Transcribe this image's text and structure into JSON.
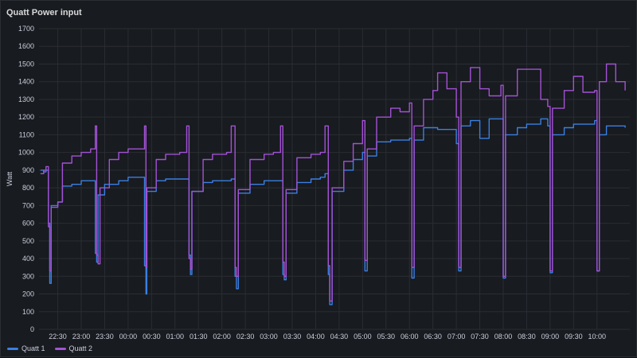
{
  "panel": {
    "title": "Quatt Power input"
  },
  "colors": {
    "quatt1": "#3a7fe3",
    "quatt2": "#a352d6",
    "grid": "#2a2d33",
    "text": "#ccccdc"
  },
  "chart_data": {
    "type": "line",
    "title": "Quatt Power input",
    "ylabel": "Watt",
    "xlabel": "",
    "ylim": [
      0,
      1700
    ],
    "yticks": [
      0,
      100,
      200,
      300,
      400,
      500,
      600,
      700,
      800,
      900,
      1000,
      1100,
      1200,
      1300,
      1400,
      1500,
      1600,
      1700
    ],
    "xlim": [
      22.1,
      34.7
    ],
    "xticks": [
      {
        "v": 22.5,
        "label": "22:30"
      },
      {
        "v": 23.0,
        "label": "23:00"
      },
      {
        "v": 23.5,
        "label": "23:30"
      },
      {
        "v": 24.0,
        "label": "00:00"
      },
      {
        "v": 24.5,
        "label": "00:30"
      },
      {
        "v": 25.0,
        "label": "01:00"
      },
      {
        "v": 25.5,
        "label": "01:30"
      },
      {
        "v": 26.0,
        "label": "02:00"
      },
      {
        "v": 26.5,
        "label": "02:30"
      },
      {
        "v": 27.0,
        "label": "03:00"
      },
      {
        "v": 27.5,
        "label": "03:30"
      },
      {
        "v": 28.0,
        "label": "04:00"
      },
      {
        "v": 28.5,
        "label": "04:30"
      },
      {
        "v": 29.0,
        "label": "05:00"
      },
      {
        "v": 29.5,
        "label": "05:30"
      },
      {
        "v": 30.0,
        "label": "06:00"
      },
      {
        "v": 30.5,
        "label": "06:30"
      },
      {
        "v": 31.0,
        "label": "07:00"
      },
      {
        "v": 31.5,
        "label": "07:30"
      },
      {
        "v": 32.0,
        "label": "08:00"
      },
      {
        "v": 32.5,
        "label": "08:30"
      },
      {
        "v": 33.0,
        "label": "09:00"
      },
      {
        "v": 33.5,
        "label": "09:30"
      },
      {
        "v": 34.0,
        "label": "10:00"
      }
    ],
    "grid": true,
    "legend": "bottom-left",
    "series": [
      {
        "name": "Quatt 1",
        "points": [
          [
            22.13,
            900
          ],
          [
            22.2,
            890
          ],
          [
            22.25,
            900
          ],
          [
            22.3,
            600
          ],
          [
            22.33,
            260
          ],
          [
            22.36,
            700
          ],
          [
            22.5,
            720
          ],
          [
            22.6,
            810
          ],
          [
            22.8,
            820
          ],
          [
            23.0,
            840
          ],
          [
            23.2,
            840
          ],
          [
            23.3,
            430
          ],
          [
            23.33,
            380
          ],
          [
            23.36,
            760
          ],
          [
            23.5,
            820
          ],
          [
            23.8,
            840
          ],
          [
            24.0,
            860
          ],
          [
            24.3,
            860
          ],
          [
            24.35,
            360
          ],
          [
            24.38,
            200
          ],
          [
            24.4,
            780
          ],
          [
            24.6,
            840
          ],
          [
            24.8,
            850
          ],
          [
            25.1,
            850
          ],
          [
            25.25,
            850
          ],
          [
            25.3,
            420
          ],
          [
            25.33,
            310
          ],
          [
            25.36,
            780
          ],
          [
            25.6,
            830
          ],
          [
            25.8,
            840
          ],
          [
            26.1,
            840
          ],
          [
            26.2,
            850
          ],
          [
            26.28,
            300
          ],
          [
            26.31,
            230
          ],
          [
            26.35,
            770
          ],
          [
            26.6,
            820
          ],
          [
            26.9,
            840
          ],
          [
            27.1,
            840
          ],
          [
            27.25,
            840
          ],
          [
            27.3,
            310
          ],
          [
            27.33,
            280
          ],
          [
            27.37,
            770
          ],
          [
            27.6,
            830
          ],
          [
            27.9,
            850
          ],
          [
            28.1,
            860
          ],
          [
            28.2,
            880
          ],
          [
            28.27,
            310
          ],
          [
            28.3,
            140
          ],
          [
            28.35,
            780
          ],
          [
            28.6,
            900
          ],
          [
            28.8,
            960
          ],
          [
            29.0,
            1000
          ],
          [
            29.05,
            330
          ],
          [
            29.1,
            980
          ],
          [
            29.3,
            1060
          ],
          [
            29.6,
            1070
          ],
          [
            29.8,
            1070
          ],
          [
            30.0,
            1080
          ],
          [
            30.05,
            290
          ],
          [
            30.1,
            1070
          ],
          [
            30.3,
            1140
          ],
          [
            30.6,
            1130
          ],
          [
            30.8,
            1130
          ],
          [
            31.0,
            1050
          ],
          [
            31.05,
            330
          ],
          [
            31.1,
            1150
          ],
          [
            31.3,
            1180
          ],
          [
            31.5,
            1080
          ],
          [
            31.7,
            1190
          ],
          [
            31.95,
            1190
          ],
          [
            32.0,
            290
          ],
          [
            32.05,
            1100
          ],
          [
            32.3,
            1140
          ],
          [
            32.5,
            1160
          ],
          [
            32.8,
            1190
          ],
          [
            32.95,
            1150
          ],
          [
            33.0,
            320
          ],
          [
            33.05,
            1100
          ],
          [
            33.3,
            1140
          ],
          [
            33.5,
            1160
          ],
          [
            33.7,
            1160
          ],
          [
            33.95,
            1180
          ],
          [
            34.0,
            330
          ],
          [
            34.05,
            1100
          ],
          [
            34.2,
            1150
          ],
          [
            34.4,
            1150
          ],
          [
            34.6,
            1140
          ]
        ]
      },
      {
        "name": "Quatt 2",
        "points": [
          [
            22.13,
            880
          ],
          [
            22.2,
            900
          ],
          [
            22.25,
            920
          ],
          [
            22.3,
            580
          ],
          [
            22.33,
            330
          ],
          [
            22.36,
            690
          ],
          [
            22.5,
            720
          ],
          [
            22.6,
            940
          ],
          [
            22.8,
            980
          ],
          [
            23.0,
            1000
          ],
          [
            23.2,
            1020
          ],
          [
            23.3,
            1150
          ],
          [
            23.33,
            420
          ],
          [
            23.36,
            370
          ],
          [
            23.4,
            800
          ],
          [
            23.6,
            960
          ],
          [
            23.8,
            1000
          ],
          [
            24.0,
            1020
          ],
          [
            24.3,
            1020
          ],
          [
            24.35,
            1150
          ],
          [
            24.38,
            350
          ],
          [
            24.4,
            800
          ],
          [
            24.6,
            960
          ],
          [
            24.8,
            990
          ],
          [
            25.1,
            1000
          ],
          [
            25.25,
            1150
          ],
          [
            25.3,
            400
          ],
          [
            25.33,
            340
          ],
          [
            25.36,
            780
          ],
          [
            25.6,
            960
          ],
          [
            25.8,
            990
          ],
          [
            26.1,
            1000
          ],
          [
            26.2,
            1150
          ],
          [
            26.28,
            350
          ],
          [
            26.31,
            300
          ],
          [
            26.35,
            790
          ],
          [
            26.6,
            960
          ],
          [
            26.9,
            990
          ],
          [
            27.1,
            1000
          ],
          [
            27.25,
            1150
          ],
          [
            27.3,
            380
          ],
          [
            27.33,
            300
          ],
          [
            27.37,
            790
          ],
          [
            27.6,
            970
          ],
          [
            27.9,
            990
          ],
          [
            28.1,
            1000
          ],
          [
            28.2,
            1150
          ],
          [
            28.27,
            360
          ],
          [
            28.3,
            160
          ],
          [
            28.35,
            800
          ],
          [
            28.6,
            950
          ],
          [
            28.8,
            1050
          ],
          [
            29.0,
            1180
          ],
          [
            29.05,
            390
          ],
          [
            29.1,
            1020
          ],
          [
            29.3,
            1200
          ],
          [
            29.6,
            1250
          ],
          [
            29.8,
            1230
          ],
          [
            30.0,
            1280
          ],
          [
            30.05,
            350
          ],
          [
            30.1,
            1150
          ],
          [
            30.3,
            1300
          ],
          [
            30.5,
            1350
          ],
          [
            30.6,
            1450
          ],
          [
            30.8,
            1360
          ],
          [
            31.0,
            1200
          ],
          [
            31.05,
            350
          ],
          [
            31.1,
            1400
          ],
          [
            31.3,
            1480
          ],
          [
            31.5,
            1360
          ],
          [
            31.7,
            1320
          ],
          [
            31.95,
            1380
          ],
          [
            32.0,
            300
          ],
          [
            32.05,
            1320
          ],
          [
            32.3,
            1470
          ],
          [
            32.5,
            1470
          ],
          [
            32.8,
            1300
          ],
          [
            32.95,
            1260
          ],
          [
            33.0,
            330
          ],
          [
            33.05,
            1250
          ],
          [
            33.3,
            1350
          ],
          [
            33.5,
            1430
          ],
          [
            33.7,
            1340
          ],
          [
            33.95,
            1350
          ],
          [
            34.0,
            330
          ],
          [
            34.05,
            1400
          ],
          [
            34.2,
            1500
          ],
          [
            34.4,
            1400
          ],
          [
            34.6,
            1350
          ]
        ]
      }
    ]
  }
}
